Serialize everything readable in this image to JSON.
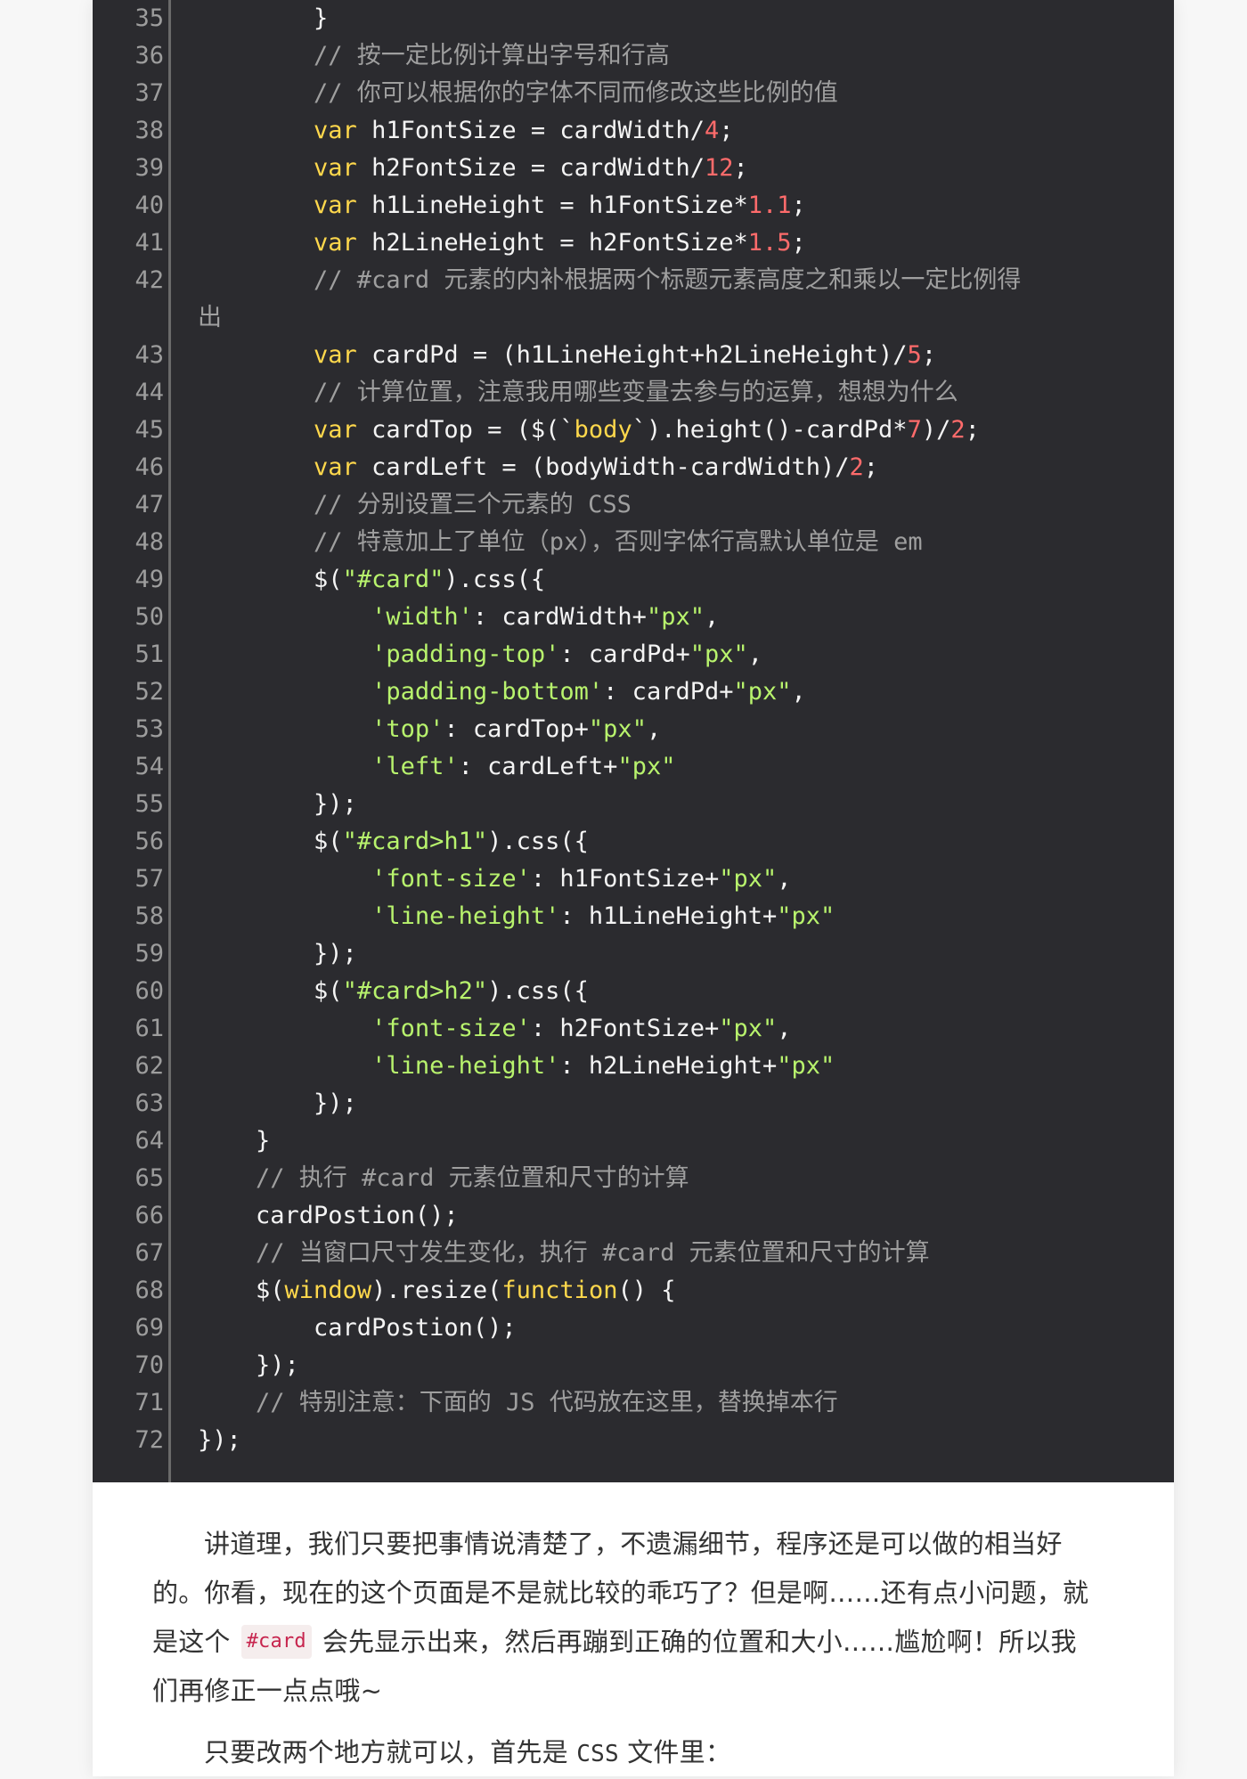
{
  "code": {
    "lines": [
      {
        "number": "35",
        "tokens": [
          {
            "text": "        }",
            "type": "plain"
          }
        ]
      },
      {
        "number": "36",
        "tokens": [
          {
            "text": "        // 按一定比例计算出字号和行高",
            "type": "comment"
          }
        ]
      },
      {
        "number": "37",
        "tokens": [
          {
            "text": "        // 你可以根据你的字体不同而修改这些比例的值",
            "type": "comment"
          }
        ]
      },
      {
        "number": "38",
        "tokens": [
          {
            "text": "        ",
            "type": "plain"
          },
          {
            "text": "var",
            "type": "keyword"
          },
          {
            "text": " h1FontSize = cardWidth/",
            "type": "plain"
          },
          {
            "text": "4",
            "type": "number"
          },
          {
            "text": ";",
            "type": "plain"
          }
        ]
      },
      {
        "number": "39",
        "tokens": [
          {
            "text": "        ",
            "type": "plain"
          },
          {
            "text": "var",
            "type": "keyword"
          },
          {
            "text": " h2FontSize = cardWidth/",
            "type": "plain"
          },
          {
            "text": "12",
            "type": "number"
          },
          {
            "text": ";",
            "type": "plain"
          }
        ]
      },
      {
        "number": "40",
        "tokens": [
          {
            "text": "        ",
            "type": "plain"
          },
          {
            "text": "var",
            "type": "keyword"
          },
          {
            "text": " h1LineHeight = h1FontSize*",
            "type": "plain"
          },
          {
            "text": "1.1",
            "type": "number"
          },
          {
            "text": ";",
            "type": "plain"
          }
        ]
      },
      {
        "number": "41",
        "tokens": [
          {
            "text": "        ",
            "type": "plain"
          },
          {
            "text": "var",
            "type": "keyword"
          },
          {
            "text": " h2LineHeight = h2FontSize*",
            "type": "plain"
          },
          {
            "text": "1.5",
            "type": "number"
          },
          {
            "text": ";",
            "type": "plain"
          }
        ]
      },
      {
        "number": "42",
        "tokens": [
          {
            "text": "        // #card 元素的内补根据两个标题元素高度之和乘以一定比例得",
            "type": "comment"
          }
        ]
      },
      {
        "number": "",
        "tokens": [
          {
            "text": "出",
            "type": "comment"
          }
        ]
      },
      {
        "number": "43",
        "tokens": [
          {
            "text": "        ",
            "type": "plain"
          },
          {
            "text": "var",
            "type": "keyword"
          },
          {
            "text": " cardPd = (h1LineHeight+h2LineHeight)/",
            "type": "plain"
          },
          {
            "text": "5",
            "type": "number"
          },
          {
            "text": ";",
            "type": "plain"
          }
        ]
      },
      {
        "number": "44",
        "tokens": [
          {
            "text": "        // 计算位置，注意我用哪些变量去参与的运算，想想为什么",
            "type": "comment"
          }
        ]
      },
      {
        "number": "45",
        "tokens": [
          {
            "text": "        ",
            "type": "plain"
          },
          {
            "text": "var",
            "type": "keyword"
          },
          {
            "text": " cardTop = ($(`",
            "type": "plain"
          },
          {
            "text": "body",
            "type": "keyword"
          },
          {
            "text": "`).height()-cardPd*",
            "type": "plain"
          },
          {
            "text": "7",
            "type": "number"
          },
          {
            "text": ")/",
            "type": "plain"
          },
          {
            "text": "2",
            "type": "number"
          },
          {
            "text": ";",
            "type": "plain"
          }
        ]
      },
      {
        "number": "46",
        "tokens": [
          {
            "text": "        ",
            "type": "plain"
          },
          {
            "text": "var",
            "type": "keyword"
          },
          {
            "text": " cardLeft = (bodyWidth-cardWidth)/",
            "type": "plain"
          },
          {
            "text": "2",
            "type": "number"
          },
          {
            "text": ";",
            "type": "plain"
          }
        ]
      },
      {
        "number": "47",
        "tokens": [
          {
            "text": "        // 分别设置三个元素的 CSS",
            "type": "comment"
          }
        ]
      },
      {
        "number": "48",
        "tokens": [
          {
            "text": "        // 特意加上了单位（px），否则字体行高默认单位是 em",
            "type": "comment"
          }
        ]
      },
      {
        "number": "49",
        "tokens": [
          {
            "text": "        $(",
            "type": "plain"
          },
          {
            "text": "\"#card\"",
            "type": "string"
          },
          {
            "text": ").css({",
            "type": "plain"
          }
        ]
      },
      {
        "number": "50",
        "tokens": [
          {
            "text": "            ",
            "type": "plain"
          },
          {
            "text": "'width'",
            "type": "string"
          },
          {
            "text": ": cardWidth+",
            "type": "plain"
          },
          {
            "text": "\"px\"",
            "type": "string"
          },
          {
            "text": ",",
            "type": "plain"
          }
        ]
      },
      {
        "number": "51",
        "tokens": [
          {
            "text": "            ",
            "type": "plain"
          },
          {
            "text": "'padding-top'",
            "type": "string"
          },
          {
            "text": ": cardPd+",
            "type": "plain"
          },
          {
            "text": "\"px\"",
            "type": "string"
          },
          {
            "text": ",",
            "type": "plain"
          }
        ]
      },
      {
        "number": "52",
        "tokens": [
          {
            "text": "            ",
            "type": "plain"
          },
          {
            "text": "'padding-bottom'",
            "type": "string"
          },
          {
            "text": ": cardPd+",
            "type": "plain"
          },
          {
            "text": "\"px\"",
            "type": "string"
          },
          {
            "text": ",",
            "type": "plain"
          }
        ]
      },
      {
        "number": "53",
        "tokens": [
          {
            "text": "            ",
            "type": "plain"
          },
          {
            "text": "'top'",
            "type": "string"
          },
          {
            "text": ": cardTop+",
            "type": "plain"
          },
          {
            "text": "\"px\"",
            "type": "string"
          },
          {
            "text": ",",
            "type": "plain"
          }
        ]
      },
      {
        "number": "54",
        "tokens": [
          {
            "text": "            ",
            "type": "plain"
          },
          {
            "text": "'left'",
            "type": "string"
          },
          {
            "text": ": cardLeft+",
            "type": "plain"
          },
          {
            "text": "\"px\"",
            "type": "string"
          }
        ]
      },
      {
        "number": "55",
        "tokens": [
          {
            "text": "        });",
            "type": "plain"
          }
        ]
      },
      {
        "number": "56",
        "tokens": [
          {
            "text": "        $(",
            "type": "plain"
          },
          {
            "text": "\"#card>h1\"",
            "type": "string"
          },
          {
            "text": ").css({",
            "type": "plain"
          }
        ]
      },
      {
        "number": "57",
        "tokens": [
          {
            "text": "            ",
            "type": "plain"
          },
          {
            "text": "'font-size'",
            "type": "string"
          },
          {
            "text": ": h1FontSize+",
            "type": "plain"
          },
          {
            "text": "\"px\"",
            "type": "string"
          },
          {
            "text": ",",
            "type": "plain"
          }
        ]
      },
      {
        "number": "58",
        "tokens": [
          {
            "text": "            ",
            "type": "plain"
          },
          {
            "text": "'line-height'",
            "type": "string"
          },
          {
            "text": ": h1LineHeight+",
            "type": "plain"
          },
          {
            "text": "\"px\"",
            "type": "string"
          }
        ]
      },
      {
        "number": "59",
        "tokens": [
          {
            "text": "        });",
            "type": "plain"
          }
        ]
      },
      {
        "number": "60",
        "tokens": [
          {
            "text": "        $(",
            "type": "plain"
          },
          {
            "text": "\"#card>h2\"",
            "type": "string"
          },
          {
            "text": ").css({",
            "type": "plain"
          }
        ]
      },
      {
        "number": "61",
        "tokens": [
          {
            "text": "            ",
            "type": "plain"
          },
          {
            "text": "'font-size'",
            "type": "string"
          },
          {
            "text": ": h2FontSize+",
            "type": "plain"
          },
          {
            "text": "\"px\"",
            "type": "string"
          },
          {
            "text": ",",
            "type": "plain"
          }
        ]
      },
      {
        "number": "62",
        "tokens": [
          {
            "text": "            ",
            "type": "plain"
          },
          {
            "text": "'line-height'",
            "type": "string"
          },
          {
            "text": ": h2LineHeight+",
            "type": "plain"
          },
          {
            "text": "\"px\"",
            "type": "string"
          }
        ]
      },
      {
        "number": "63",
        "tokens": [
          {
            "text": "        });",
            "type": "plain"
          }
        ]
      },
      {
        "number": "64",
        "tokens": [
          {
            "text": "    }",
            "type": "plain"
          }
        ]
      },
      {
        "number": "65",
        "tokens": [
          {
            "text": "    // 执行 #card 元素位置和尺寸的计算",
            "type": "comment"
          }
        ]
      },
      {
        "number": "66",
        "tokens": [
          {
            "text": "    cardPostion();",
            "type": "plain"
          }
        ]
      },
      {
        "number": "67",
        "tokens": [
          {
            "text": "    // 当窗口尺寸发生变化，执行 #card 元素位置和尺寸的计算",
            "type": "comment"
          }
        ]
      },
      {
        "number": "68",
        "tokens": [
          {
            "text": "    $(",
            "type": "plain"
          },
          {
            "text": "window",
            "type": "keyword"
          },
          {
            "text": ").resize(",
            "type": "plain"
          },
          {
            "text": "function",
            "type": "keyword"
          },
          {
            "text": "() {",
            "type": "plain"
          }
        ]
      },
      {
        "number": "69",
        "tokens": [
          {
            "text": "        cardPostion();",
            "type": "plain"
          }
        ]
      },
      {
        "number": "70",
        "tokens": [
          {
            "text": "    });",
            "type": "plain"
          }
        ]
      },
      {
        "number": "71",
        "tokens": [
          {
            "text": "    // 特别注意：下面的 JS 代码放在这里，替换掉本行",
            "type": "comment"
          }
        ]
      },
      {
        "number": "72",
        "tokens": [
          {
            "text": "});",
            "type": "plain"
          }
        ]
      }
    ]
  },
  "prose": {
    "paragraph_1": {
      "line_1": "讲道理，我们只要把事情说清楚了，不遗漏细节，程序还是可以做的相当好",
      "line_2": "的。你看，现在的这个页面是不是就比较的乖巧了？但是啊……还有点小问题，就",
      "line_3_before": "是这个",
      "line_3_code": "#card",
      "line_3_after": "会先显示出来，然后再蹦到正确的位置和大小……尴尬啊！所以我",
      "line_4": "们再修正一点点哦~"
    },
    "paragraph_2": {
      "before": "只要改两个地方就可以，首先是 ",
      "code": "CSS",
      "after": " 文件里："
    }
  },
  "colors": {
    "code_background": "#2b2b2f",
    "line_number": "#9d9d9d",
    "plain": "#f4f4f4",
    "comment": "#9f9f9f",
    "keyword": "#ffd84c",
    "number": "#ff6b6b",
    "string": "#b8f36d",
    "inline_code_text": "#c7254e",
    "inline_code_background": "#f5eded"
  }
}
